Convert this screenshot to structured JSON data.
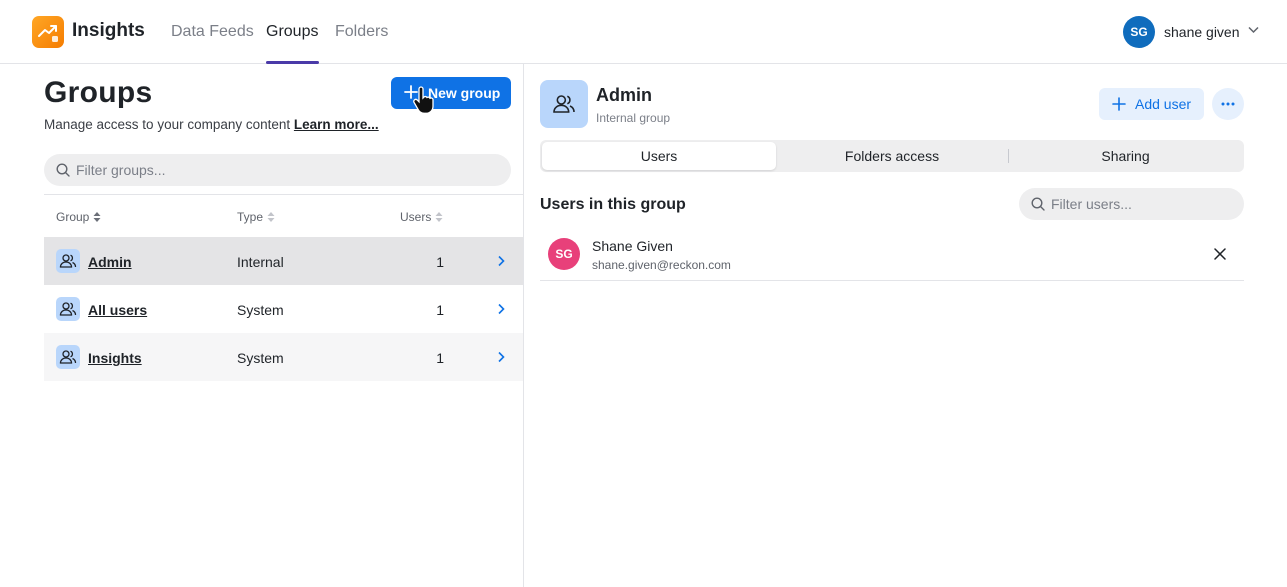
{
  "app": {
    "name": "Insights"
  },
  "nav": {
    "tabs": [
      "Data Feeds",
      "Groups",
      "Folders"
    ],
    "active": "Groups"
  },
  "user": {
    "initials": "SG",
    "name": "shane given"
  },
  "groups_panel": {
    "title": "Groups",
    "subtitle": "Manage access to your company content",
    "learn_more": "Learn more...",
    "new_group": "New group",
    "filter_placeholder": "Filter groups...",
    "columns": {
      "group": "Group",
      "type": "Type",
      "users": "Users"
    },
    "rows": [
      {
        "name": "Admin",
        "type": "Internal",
        "users": "1",
        "selected": true
      },
      {
        "name": "All users",
        "type": "System",
        "users": "1",
        "selected": false
      },
      {
        "name": "Insights",
        "type": "System",
        "users": "1",
        "selected": false
      }
    ]
  },
  "detail": {
    "title": "Admin",
    "subtitle": "Internal group",
    "add_user": "Add user",
    "tabs": [
      "Users",
      "Folders access",
      "Sharing"
    ],
    "active_tab": "Users",
    "users_heading": "Users in this group",
    "filter_placeholder": "Filter users...",
    "members": [
      {
        "initials": "SG",
        "name": "Shane Given",
        "email": "shane.given@reckon.com"
      }
    ]
  },
  "colors": {
    "accent": "#0f72e5",
    "nav_underline": "#4a3aa8",
    "logo": "#f57c00",
    "group_icon_bg": "#b9d6fb",
    "user_avatar": "#0f6cbd",
    "member_avatar": "#e8407a"
  }
}
